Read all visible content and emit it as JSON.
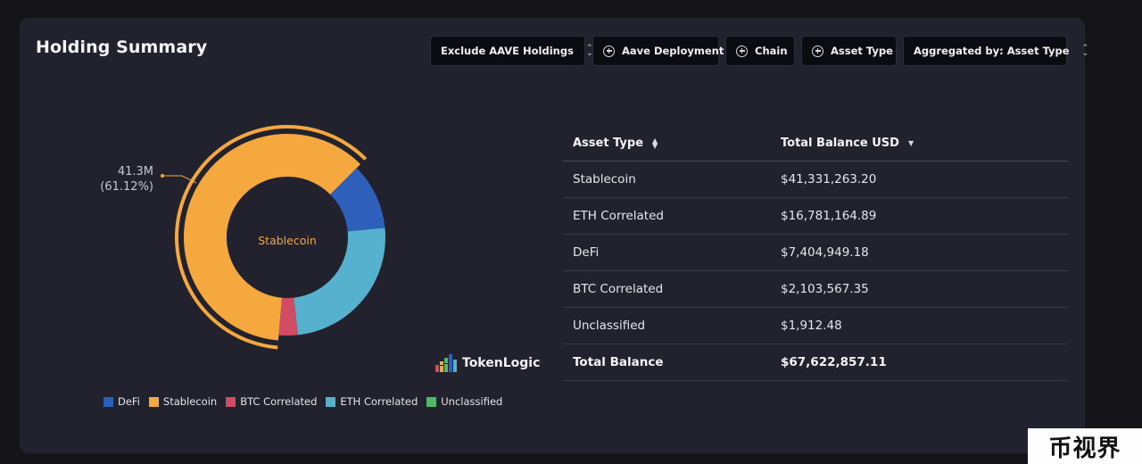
{
  "header": {
    "title": "Holding Summary",
    "buttons": [
      {
        "label": "Exclude AAVE Holdings",
        "icon": "select-updown-icon"
      },
      {
        "label": "Aave Deployment",
        "icon": "plus-circle-icon"
      },
      {
        "label": "Chain",
        "icon": "plus-circle-icon"
      },
      {
        "label": "Asset Type",
        "icon": "plus-circle-icon"
      },
      {
        "label": "Aggregated by: Asset Type",
        "icon": "select-updown-icon"
      }
    ]
  },
  "chart_data": {
    "type": "pie",
    "donut": true,
    "center_label": "Stablecoin",
    "callout": {
      "value": "41.3M",
      "percent": "(61.12%)"
    },
    "slices": [
      {
        "name": "Stablecoin",
        "value": 41331263.2,
        "color": "#f4a83e"
      },
      {
        "name": "DeFi",
        "value": 7404949.18,
        "color": "#2d5fbb"
      },
      {
        "name": "ETH Correlated",
        "value": 16781164.89,
        "color": "#56b1cf"
      },
      {
        "name": "BTC Correlated",
        "value": 2103567.35,
        "color": "#d04b64"
      },
      {
        "name": "Unclassified",
        "value": 1912.48,
        "color": "#54b66a"
      }
    ],
    "highlighted": "Stablecoin",
    "legend": [
      {
        "name": "DeFi",
        "color": "#2d5fbb"
      },
      {
        "name": "Stablecoin",
        "color": "#f4a83e"
      },
      {
        "name": "BTC Correlated",
        "color": "#d04b64"
      },
      {
        "name": "ETH Correlated",
        "color": "#56b1cf"
      },
      {
        "name": "Unclassified",
        "color": "#54b66a"
      }
    ],
    "legend_position": "bottom"
  },
  "brand": {
    "name": "TokenLogic"
  },
  "table": {
    "columns": [
      "Asset Type",
      "Total Balance USD"
    ],
    "rows": [
      {
        "asset": "Stablecoin",
        "balance": "$41,331,263.20"
      },
      {
        "asset": "ETH Correlated",
        "balance": "$16,781,164.89"
      },
      {
        "asset": "DeFi",
        "balance": "$7,404,949.18"
      },
      {
        "asset": "BTC Correlated",
        "balance": "$2,103,567.35"
      },
      {
        "asset": "Unclassified",
        "balance": "$1,912.48"
      }
    ],
    "total": {
      "label": "Total Balance",
      "value": "$67,622,857.11"
    }
  },
  "watermark": "币视界"
}
